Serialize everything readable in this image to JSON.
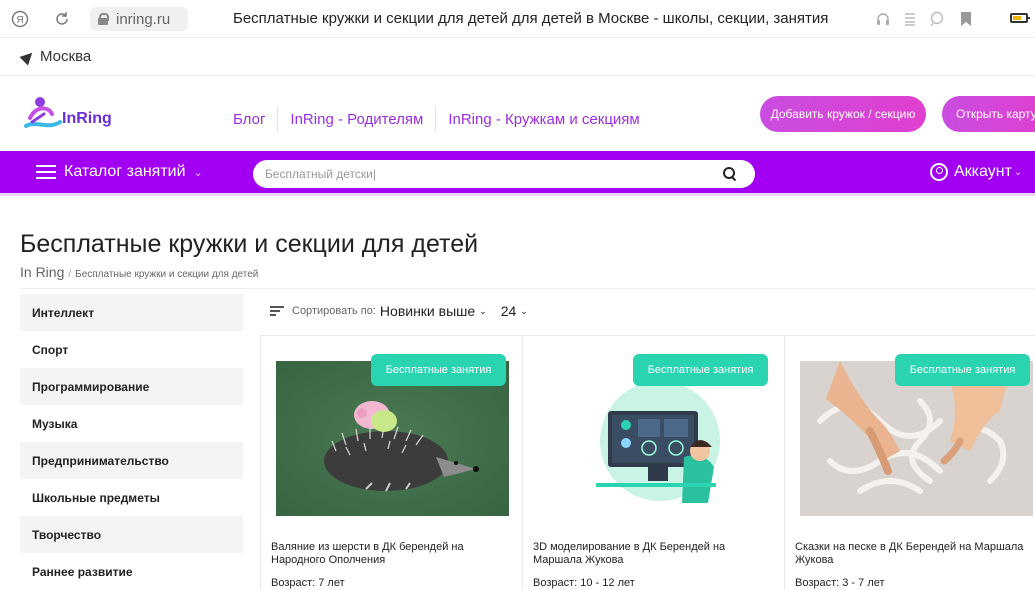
{
  "browser": {
    "domain": "inring.ru",
    "tab_title": "Бесплатные кружки и секции для детей для детей в Москве - школы, секции, занятия"
  },
  "city": "Москва",
  "logo": {
    "text": "InRing"
  },
  "nav": {
    "links": [
      "Блог",
      "InRing - Родителям",
      "InRing - Кружкам и секциям"
    ],
    "add_button": "Добавить кружок / секцию",
    "map_button": "Открыть карту"
  },
  "catalog_bar": {
    "catalog_label": "Каталог занятий",
    "search_value": "Бесплатный детски|",
    "account_label": "Аккаунт"
  },
  "page": {
    "title": "Бесплатные кружки и секции для детей",
    "breadcrumb_home": "In Ring",
    "breadcrumb_current": "Бесплатные кружки и секции для детей"
  },
  "sidebar": {
    "items": [
      "Интеллект",
      "Спорт",
      "Программирование",
      "Музыка",
      "Предпринимательство",
      "Школьные предметы",
      "Творчество",
      "Раннее развитие"
    ]
  },
  "sort": {
    "label": "Сортировать по:",
    "value": "Новинки выше",
    "per_page": "24"
  },
  "cards": [
    {
      "badge": "Бесплатные занятия",
      "title": "Валяние из шерсти в ДК берендей на Народного Ополчения",
      "age": "Возраст: 7 лет"
    },
    {
      "badge": "Бесплатные занятия",
      "title": "3D моделирование в ДК Берендей на Маршала Жукова",
      "age": "Возраст: 10 - 12 лет"
    },
    {
      "badge": "Бесплатные занятия",
      "title": "Сказки на песке в ДК Берендей на Маршала Жукова",
      "age": "Возраст: 3 - 7 лет"
    }
  ],
  "colors": {
    "brand_purple": "#a100f2",
    "link_purple": "#9b2fe0",
    "badge_teal": "#2bd4b0",
    "button_pink": "#d845da"
  }
}
